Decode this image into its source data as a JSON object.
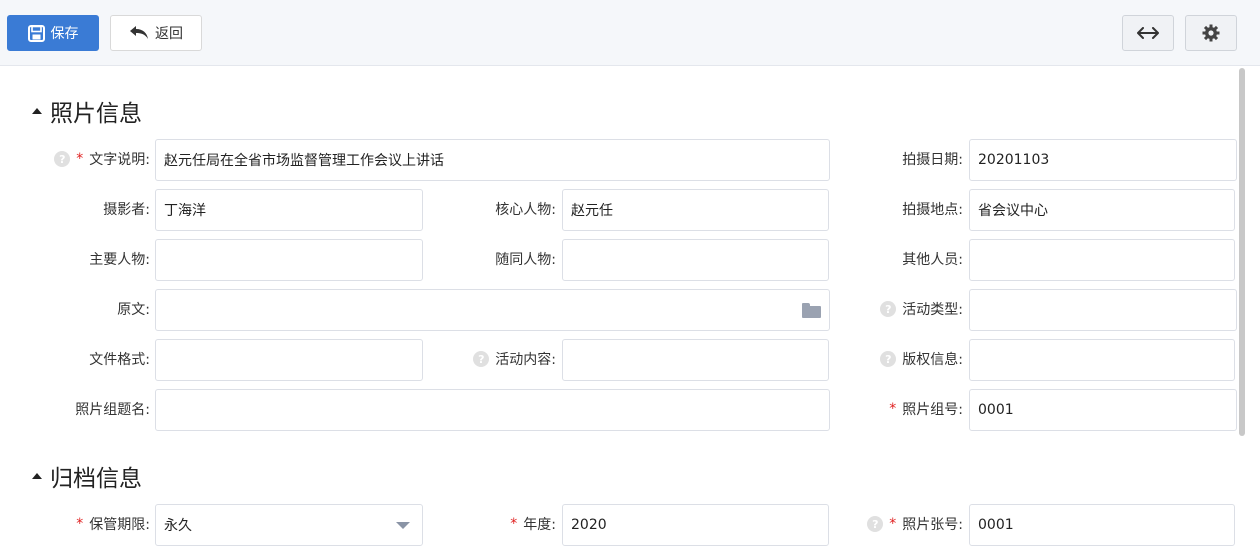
{
  "toolbar": {
    "save_label": "保存",
    "back_label": "返回"
  },
  "sections": {
    "photo": {
      "title": "照片信息"
    },
    "archive": {
      "title": "归档信息"
    }
  },
  "fields": {
    "caption": {
      "label": "文字说明:",
      "value": "赵元任局在全省市场监督管理工作会议上讲话"
    },
    "shoot_date": {
      "label": "拍摄日期:",
      "value": "20201103"
    },
    "photographer": {
      "label": "摄影者:",
      "value": "丁海洋"
    },
    "core_person": {
      "label": "核心人物:",
      "value": "赵元任"
    },
    "shoot_place": {
      "label": "拍摄地点:",
      "value": "省会议中心"
    },
    "main_person": {
      "label": "主要人物:",
      "value": ""
    },
    "accompany_person": {
      "label": "随同人物:",
      "value": ""
    },
    "other_person": {
      "label": "其他人员:",
      "value": ""
    },
    "original_text": {
      "label": "原文:",
      "value": ""
    },
    "activity_type": {
      "label": "活动类型:",
      "value": ""
    },
    "file_format": {
      "label": "文件格式:",
      "value": ""
    },
    "activity_content": {
      "label": "活动内容:",
      "value": ""
    },
    "copyright": {
      "label": "版权信息:",
      "value": ""
    },
    "group_title": {
      "label": "照片组题名:",
      "value": ""
    },
    "group_number": {
      "label": "照片组号:",
      "value": "0001"
    },
    "retention": {
      "label": "保管期限:",
      "value": "永久"
    },
    "year": {
      "label": "年度:",
      "value": "2020"
    },
    "photo_number": {
      "label": "照片张号:",
      "value": "0001"
    }
  },
  "help_mark": "?",
  "required_mark": "*",
  "colors": {
    "primary": "#3a7bd5",
    "required": "#e02020",
    "border": "#dcdfe6"
  }
}
